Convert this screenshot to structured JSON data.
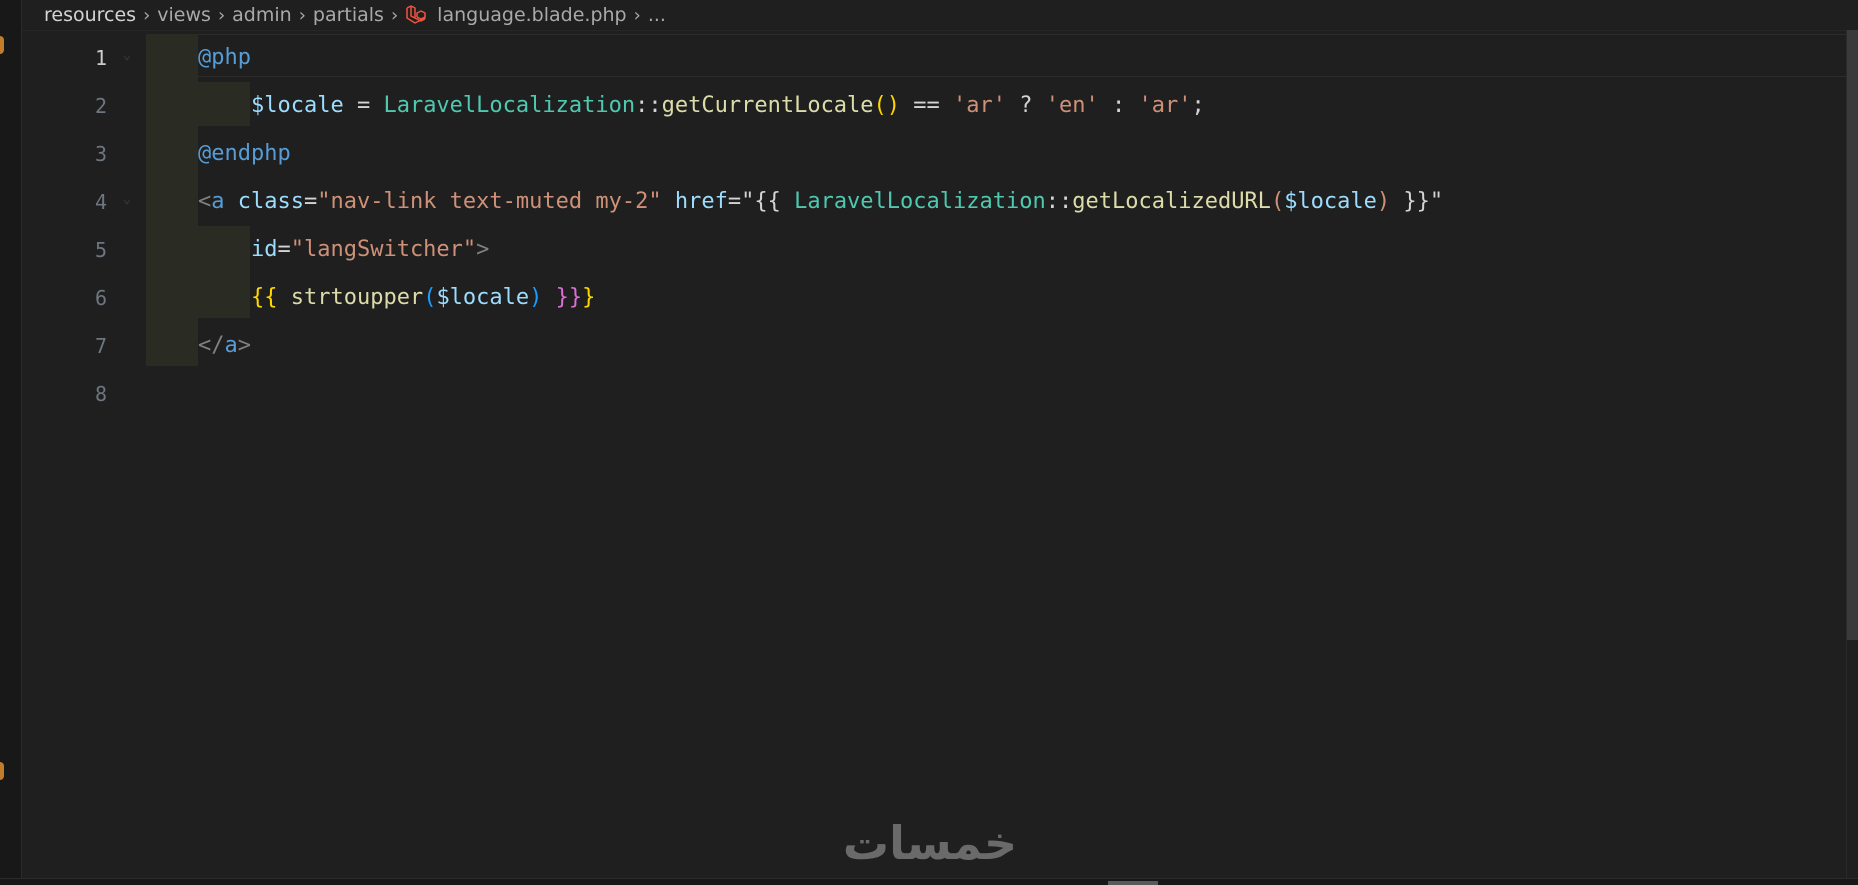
{
  "breadcrumb": {
    "items": [
      "resources",
      "views",
      "admin",
      "partials"
    ],
    "file_name": "language.blade.php",
    "more": "...",
    "file_icon": "laravel-icon"
  },
  "editor": {
    "active_line": 1,
    "line_numbers": [
      "1",
      "2",
      "3",
      "4",
      "5",
      "6",
      "7",
      "8"
    ],
    "lines": [
      [
        {
          "t": "@php",
          "c": "directive"
        }
      ],
      [
        {
          "t": "    ",
          "c": ""
        },
        {
          "t": "$locale",
          "c": "variable"
        },
        {
          "t": " = ",
          "c": "operator"
        },
        {
          "t": "LaravelLocalization",
          "c": "class-name"
        },
        {
          "t": "::",
          "c": "operator"
        },
        {
          "t": "getCurrentLocale",
          "c": "method"
        },
        {
          "t": "()",
          "c": "brace-yellow"
        },
        {
          "t": " == ",
          "c": "operator"
        },
        {
          "t": "'ar'",
          "c": "string"
        },
        {
          "t": " ? ",
          "c": "operator"
        },
        {
          "t": "'en'",
          "c": "string"
        },
        {
          "t": " : ",
          "c": "operator"
        },
        {
          "t": "'ar'",
          "c": "string"
        },
        {
          "t": ";",
          "c": "operator"
        }
      ],
      [
        {
          "t": "@endphp",
          "c": "directive"
        }
      ],
      [
        {
          "t": "<",
          "c": "tag-bracket"
        },
        {
          "t": "a",
          "c": "tag"
        },
        {
          "t": " ",
          "c": ""
        },
        {
          "t": "class",
          "c": "attr"
        },
        {
          "t": "=",
          "c": "operator"
        },
        {
          "t": "\"nav-link text-muted my-2\"",
          "c": "string"
        },
        {
          "t": " ",
          "c": ""
        },
        {
          "t": "href",
          "c": "attr"
        },
        {
          "t": "=\"{{ ",
          "c": "operator"
        },
        {
          "t": "LaravelLocalization",
          "c": "class-name"
        },
        {
          "t": "::",
          "c": "operator"
        },
        {
          "t": "getLocalizedURL",
          "c": "method"
        },
        {
          "t": "(",
          "c": "string"
        },
        {
          "t": "$locale",
          "c": "variable"
        },
        {
          "t": ")",
          "c": "string"
        },
        {
          "t": " }}\"",
          "c": "operator"
        }
      ],
      [
        {
          "t": "    ",
          "c": ""
        },
        {
          "t": "id",
          "c": "attr"
        },
        {
          "t": "=",
          "c": "operator"
        },
        {
          "t": "\"langSwitcher\"",
          "c": "string"
        },
        {
          "t": ">",
          "c": "tag-bracket"
        }
      ],
      [
        {
          "t": "    ",
          "c": ""
        },
        {
          "t": "{{",
          "c": "brace-yellow"
        },
        {
          "t": " ",
          "c": ""
        },
        {
          "t": "strtoupper",
          "c": "method"
        },
        {
          "t": "(",
          "c": "brace-blue"
        },
        {
          "t": "$locale",
          "c": "variable"
        },
        {
          "t": ")",
          "c": "brace-blue"
        },
        {
          "t": " ",
          "c": ""
        },
        {
          "t": "}}",
          "c": "brace-pink"
        },
        {
          "t": "}",
          "c": "brace-yellow"
        }
      ],
      [
        {
          "t": "</",
          "c": "tag-bracket"
        },
        {
          "t": "a",
          "c": "tag"
        },
        {
          "t": ">",
          "c": "tag-bracket"
        }
      ],
      []
    ]
  },
  "watermark": {
    "text": "خمسات",
    "color": "#6a6a6a"
  },
  "colors": {
    "background": "#1f1f1f",
    "indent_guide": "#2a2c23",
    "laravel_red": "#f05340"
  }
}
